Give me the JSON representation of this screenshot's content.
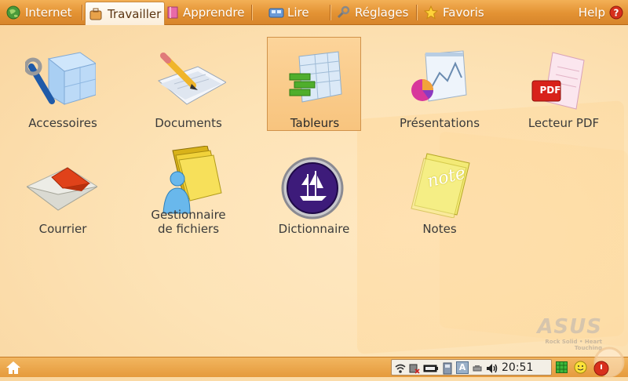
{
  "tabs": [
    {
      "label": "Internet",
      "icon": "globe-icon"
    },
    {
      "label": "Travailler",
      "icon": "briefcase-icon",
      "active": true
    },
    {
      "label": "Apprendre",
      "icon": "book-icon"
    },
    {
      "label": "Lire",
      "icon": "media-icon"
    },
    {
      "label": "Réglages",
      "icon": "wrench-icon"
    },
    {
      "label": "Favoris",
      "icon": "star-icon"
    }
  ],
  "help": {
    "label": "Help",
    "icon": "help-icon"
  },
  "apps": [
    {
      "label": "Accessoires",
      "icon": "accessories-icon"
    },
    {
      "label": "Documents",
      "icon": "documents-icon"
    },
    {
      "label": "Tableurs",
      "icon": "spreadsheet-icon",
      "selected": true
    },
    {
      "label": "Présentations",
      "icon": "presentation-icon"
    },
    {
      "label": "Lecteur PDF",
      "icon": "pdf-icon",
      "pdf_badge": "PDF"
    },
    {
      "label": "Courrier",
      "icon": "mail-icon"
    },
    {
      "label": "Gestionnaire de fichiers",
      "label_line1": "Gestionnaire",
      "label_line2": "de fichiers",
      "icon": "file-manager-icon"
    },
    {
      "label": "Dictionnaire",
      "icon": "dictionary-icon"
    },
    {
      "label": "Notes",
      "icon": "notes-icon",
      "note_text": "note"
    }
  ],
  "watermark": {
    "brand": "ASUS",
    "tagline": "Rock Solid • Heart Touching"
  },
  "taskbar": {
    "home_icon": "home-icon",
    "tray_icons": [
      "network-icon",
      "keyboard-icon",
      "battery-icon",
      "disk-icon",
      "language-icon",
      "usb-icon",
      "volume-icon"
    ],
    "language_letter": "A",
    "clock": "20:51",
    "right_icons": [
      "grid-icon",
      "smiley-icon",
      "shutdown-icon"
    ]
  },
  "colors": {
    "accent": "#e39233",
    "selected_bg": "#f8c47e"
  }
}
